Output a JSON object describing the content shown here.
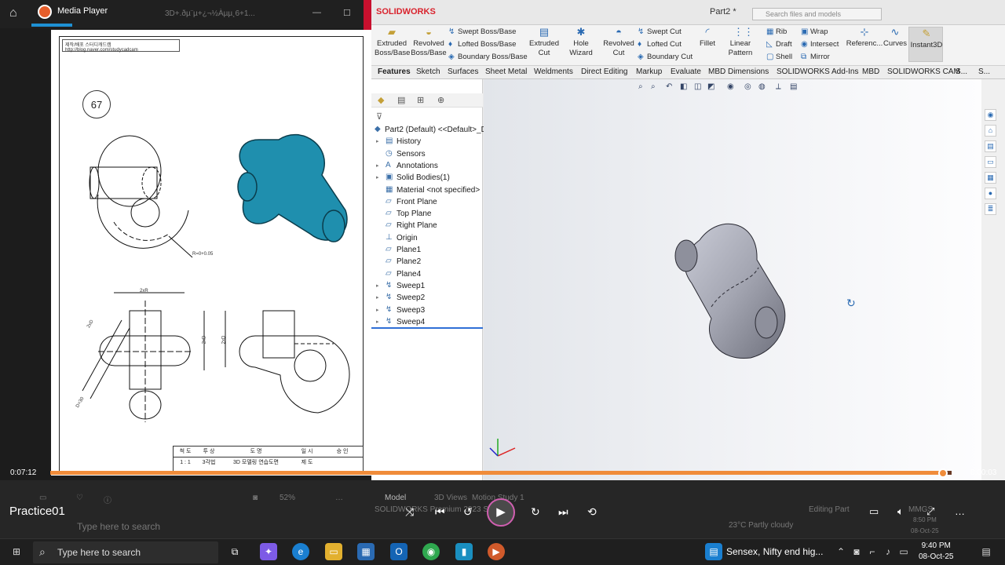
{
  "media_player": {
    "title": "Media Player",
    "ghost_title": "3D+.ðµ¨µ+¿¬½Àµµ¸6+1...",
    "window_controls": [
      "—",
      "☐"
    ],
    "zoom": "52%",
    "time_elapsed": "0:07:12",
    "time_total": "0:00:03",
    "progress": 0.99,
    "clip_title": "Practice01"
  },
  "drawing": {
    "header_line1": "제작/배포  스터디캐드캠",
    "header_line2": "http://blog.naver.com/studycadcam",
    "number": "67",
    "dim_r": "R=0+0.05",
    "dim_top": "2xR",
    "dim_left": "2xD",
    "dim_side": "2xD",
    "dim_dia": "D=30",
    "dim_right": "2xD",
    "title_block": {
      "row1": [
        "척 도",
        "투 상",
        "도  명",
        "일 시",
        "승 인"
      ],
      "row2": [
        "1 : 1",
        "3각법",
        "3D 모델링 연습도면",
        "제 도",
        ""
      ]
    }
  },
  "solidworks": {
    "brand": "SOLIDWORKS",
    "part_title": "Part2 *",
    "search_placeholder": "Search files and models",
    "ribbon": {
      "extruded_boss": "Extruded Boss/Base",
      "revolved_boss": "Revolved Boss/Base",
      "swept_boss": "Swept Boss/Base",
      "lofted_boss": "Lofted Boss/Base",
      "boundary_boss": "Boundary Boss/Base",
      "extruded_cut": "Extruded Cut",
      "hole_wizard": "Hole Wizard",
      "revolved_cut": "Revolved Cut",
      "swept_cut": "Swept Cut",
      "lofted_cut": "Lofted Cut",
      "boundary_cut": "Boundary Cut",
      "fillet": "Fillet",
      "linear_pattern": "Linear Pattern",
      "rib": "Rib",
      "draft": "Draft",
      "shell": "Shell",
      "wrap": "Wrap",
      "intersect": "Intersect",
      "mirror": "Mirror",
      "reference": "Referenc...",
      "curves": "Curves",
      "instant3d": "Instant3D"
    },
    "tabs": [
      "Features",
      "Sketch",
      "Surfaces",
      "Sheet Metal",
      "Weldments",
      "Direct Editing",
      "Markup",
      "Evaluate",
      "MBD Dimensions",
      "SOLIDWORKS Add-Ins",
      "MBD",
      "SOLIDWORKS CAM",
      "S...",
      "S..."
    ],
    "tree": [
      {
        "label": "Part2 (Default) <<Default>_D",
        "icon": "part-icon",
        "arrow": ""
      },
      {
        "label": "History",
        "icon": "history-icon",
        "arrow": "▸"
      },
      {
        "label": "Sensors",
        "icon": "sensor-icon",
        "arrow": ""
      },
      {
        "label": "Annotations",
        "icon": "annotation-icon",
        "arrow": "▸"
      },
      {
        "label": "Solid Bodies(1)",
        "icon": "solid-bodies-icon",
        "arrow": "▸"
      },
      {
        "label": "Material <not specified>",
        "icon": "material-icon",
        "arrow": ""
      },
      {
        "label": "Front Plane",
        "icon": "plane-icon",
        "arrow": ""
      },
      {
        "label": "Top Plane",
        "icon": "plane-icon",
        "arrow": ""
      },
      {
        "label": "Right Plane",
        "icon": "plane-icon",
        "arrow": ""
      },
      {
        "label": "Origin",
        "icon": "origin-icon",
        "arrow": ""
      },
      {
        "label": "Plane1",
        "icon": "plane-icon",
        "arrow": ""
      },
      {
        "label": "Plane2",
        "icon": "plane-icon",
        "arrow": ""
      },
      {
        "label": "Plane4",
        "icon": "plane-icon",
        "arrow": ""
      },
      {
        "label": "Sweep1",
        "icon": "sweep-icon",
        "arrow": "▸"
      },
      {
        "label": "Sweep2",
        "icon": "sweep-icon",
        "arrow": "▸"
      },
      {
        "label": "Sweep3",
        "icon": "sweep-icon",
        "arrow": "▸"
      },
      {
        "label": "Sweep4",
        "icon": "sweep-icon",
        "arrow": "▸"
      }
    ],
    "bottom_tabs": [
      "Model",
      "3D Views",
      "Motion Study 1"
    ],
    "status": {
      "left": "SOLIDWORKS Premium 2023 SP0",
      "editing": "Editing Part",
      "units": "MMGS"
    }
  },
  "taskbar": {
    "search_placeholder": "Type here to search",
    "news": "Sensex, Nifty end hig...",
    "time": "9:40 PM",
    "date": "08-Oct-25",
    "weather": "23°C  Partly cloudy",
    "ghost_time": "8:50 PM",
    "ghost_date": "08-Oct-25"
  },
  "colors": {
    "accent_orange": "#f08c3a",
    "model_teal": "#1f8fae",
    "model_grey": "#a8aab6",
    "sw_red": "#d9232d"
  }
}
